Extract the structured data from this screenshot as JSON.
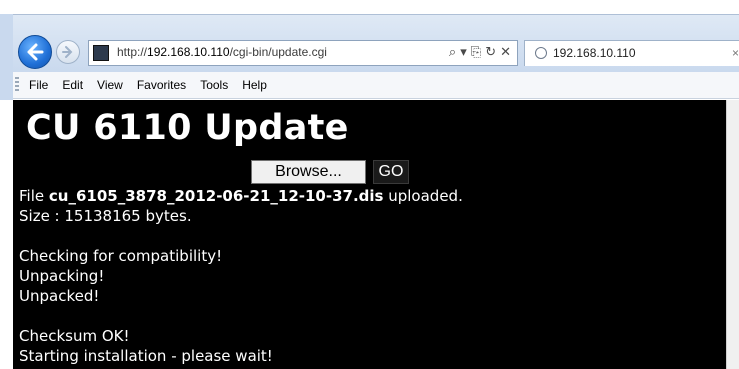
{
  "browser": {
    "address": {
      "prefix": "http://",
      "host": "192.168.10.110",
      "path": "/cgi-bin/update.cgi"
    },
    "tab": {
      "title": "192.168.10.110",
      "close": "×"
    },
    "address_tools": [
      "⌕ ▾",
      "⎘",
      "↻",
      "✕"
    ],
    "menu": [
      "File",
      "Edit",
      "View",
      "Favorites",
      "Tools",
      "Help"
    ]
  },
  "page": {
    "title": "CU 6110 Update",
    "browse_label": "Browse...",
    "go_label": "GO",
    "file_line": {
      "prefix": "File ",
      "filename": "cu_6105_3878_2012-06-21_12-10-37.dis",
      "suffix": " uploaded."
    },
    "size_line": "Size : 15138165 bytes.",
    "status_lines_1": [
      "Checking for compatibility!",
      "Unpacking!",
      "Unpacked!"
    ],
    "status_lines_2": [
      "Checksum OK!",
      "Starting installation - please wait!"
    ]
  },
  "colors": {
    "page_bg": "#000000",
    "page_text": "#ffffff",
    "chrome_blue": "#c9d9ee",
    "back_button": "#1f6fd6"
  }
}
